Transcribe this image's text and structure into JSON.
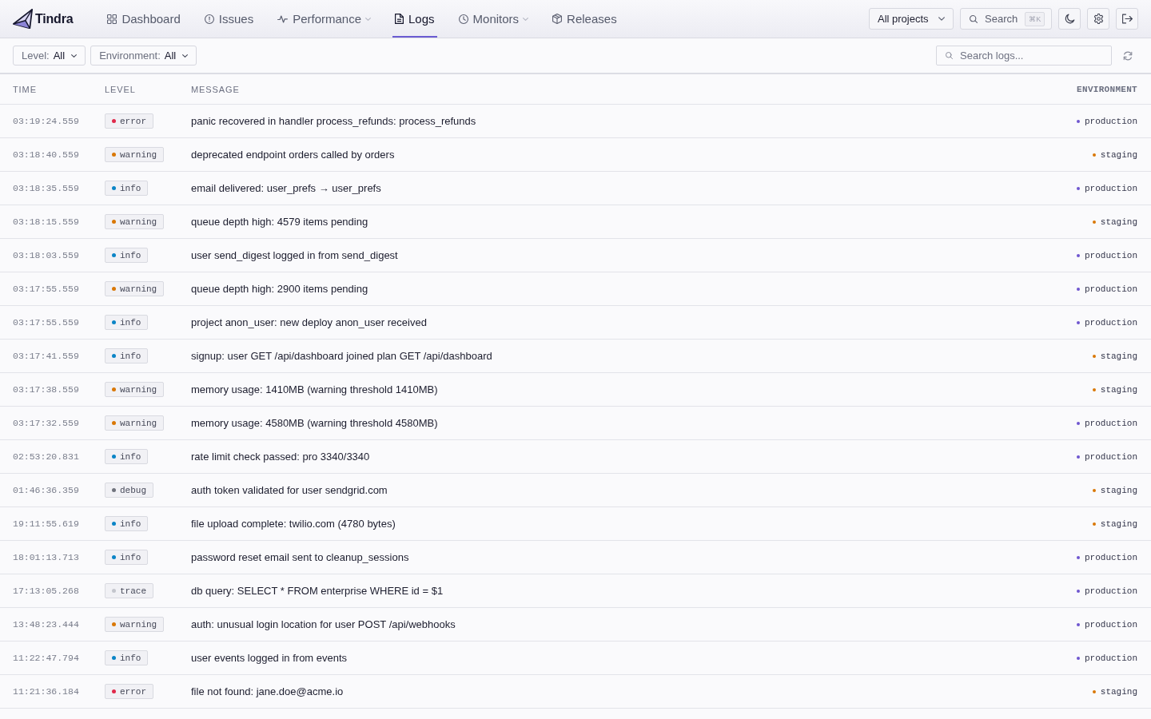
{
  "header": {
    "brand": "Tindra",
    "nav": [
      {
        "label": "Dashboard",
        "selected": false,
        "dropdown": false
      },
      {
        "label": "Issues",
        "selected": false,
        "dropdown": false
      },
      {
        "label": "Performance",
        "selected": false,
        "dropdown": true
      },
      {
        "label": "Logs",
        "selected": true,
        "dropdown": false
      },
      {
        "label": "Monitors",
        "selected": false,
        "dropdown": true
      },
      {
        "label": "Releases",
        "selected": false,
        "dropdown": false
      }
    ],
    "project_selector": {
      "label": "All projects"
    },
    "search": {
      "label": "Search",
      "shortcut": "⌘K"
    }
  },
  "filters": [
    {
      "label": "Level:",
      "value": "All"
    },
    {
      "label": "Environment:",
      "value": "All"
    }
  ],
  "log_search": {
    "placeholder": "Search logs..."
  },
  "table": {
    "columns": [
      "TIME",
      "LEVEL",
      "MESSAGE",
      "ENVIRONMENT"
    ],
    "rows": [
      {
        "time": "03:19:24.559",
        "severity": {
          "text": "error",
          "color": "#e0294a"
        },
        "message": "panic recovered in handler process_refunds: process_refunds",
        "environment": {
          "text": "production",
          "color": "#6e56cf"
        }
      },
      {
        "time": "03:18:40.559",
        "severity": {
          "text": "warning",
          "color": "#d97706"
        },
        "message": "deprecated endpoint orders called by orders",
        "environment": {
          "text": "staging",
          "color": "#d97706"
        }
      },
      {
        "time": "03:18:35.559",
        "severity": {
          "text": "info",
          "color": "#0a84c6"
        },
        "message": "email delivered: user_prefs → user_prefs",
        "environment": {
          "text": "production",
          "color": "#6e56cf"
        }
      },
      {
        "time": "03:18:15.559",
        "severity": {
          "text": "warning",
          "color": "#d97706"
        },
        "message": "queue depth high: 4579 items pending",
        "environment": {
          "text": "staging",
          "color": "#d97706"
        }
      },
      {
        "time": "03:18:03.559",
        "severity": {
          "text": "info",
          "color": "#0a84c6"
        },
        "message": "user send_digest logged in from send_digest",
        "environment": {
          "text": "production",
          "color": "#6e56cf"
        }
      },
      {
        "time": "03:17:55.559",
        "severity": {
          "text": "warning",
          "color": "#d97706"
        },
        "message": "queue depth high: 2900 items pending",
        "environment": {
          "text": "production",
          "color": "#6e56cf"
        }
      },
      {
        "time": "03:17:55.559",
        "severity": {
          "text": "info",
          "color": "#0a84c6"
        },
        "message": "project anon_user: new deploy anon_user received",
        "environment": {
          "text": "production",
          "color": "#6e56cf"
        }
      },
      {
        "time": "03:17:41.559",
        "severity": {
          "text": "info",
          "color": "#0a84c6"
        },
        "message": "signup: user GET /api/dashboard joined plan GET /api/dashboard",
        "environment": {
          "text": "staging",
          "color": "#d97706"
        }
      },
      {
        "time": "03:17:38.559",
        "severity": {
          "text": "warning",
          "color": "#d97706"
        },
        "message": "memory usage: 1410MB (warning threshold 1410MB)",
        "environment": {
          "text": "staging",
          "color": "#d97706"
        }
      },
      {
        "time": "03:17:32.559",
        "severity": {
          "text": "warning",
          "color": "#d97706"
        },
        "message": "memory usage: 4580MB (warning threshold 4580MB)",
        "environment": {
          "text": "production",
          "color": "#6e56cf"
        }
      },
      {
        "time": "02:53:20.831",
        "severity": {
          "text": "info",
          "color": "#0a84c6"
        },
        "message": "rate limit check passed: pro 3340/3340",
        "environment": {
          "text": "production",
          "color": "#6e56cf"
        }
      },
      {
        "time": "01:46:36.359",
        "severity": {
          "text": "debug",
          "color": "#70737d"
        },
        "message": "auth token validated for user sendgrid.com",
        "environment": {
          "text": "staging",
          "color": "#d97706"
        }
      },
      {
        "time": "19:11:55.619",
        "severity": {
          "text": "info",
          "color": "#0a84c6"
        },
        "message": "file upload complete: twilio.com (4780 bytes)",
        "environment": {
          "text": "staging",
          "color": "#d97706"
        }
      },
      {
        "time": "18:01:13.713",
        "severity": {
          "text": "info",
          "color": "#0a84c6"
        },
        "message": "password reset email sent to cleanup_sessions",
        "environment": {
          "text": "production",
          "color": "#6e56cf"
        }
      },
      {
        "time": "17:13:05.268",
        "severity": {
          "text": "trace",
          "color": "#c4c6cd"
        },
        "message": "db query: SELECT * FROM enterprise WHERE id = $1",
        "environment": {
          "text": "production",
          "color": "#6e56cf"
        }
      },
      {
        "time": "13:48:23.444",
        "severity": {
          "text": "warning",
          "color": "#d97706"
        },
        "message": "auth: unusual login location for user POST /api/webhooks",
        "environment": {
          "text": "production",
          "color": "#6e56cf"
        }
      },
      {
        "time": "11:22:47.794",
        "severity": {
          "text": "info",
          "color": "#0a84c6"
        },
        "message": "user events logged in from events",
        "environment": {
          "text": "production",
          "color": "#6e56cf"
        }
      },
      {
        "time": "11:21:36.184",
        "severity": {
          "text": "error",
          "color": "#e0294a"
        },
        "message": "file not found: jane.doe@acme.io",
        "environment": {
          "text": "staging",
          "color": "#d97706"
        }
      }
    ]
  }
}
